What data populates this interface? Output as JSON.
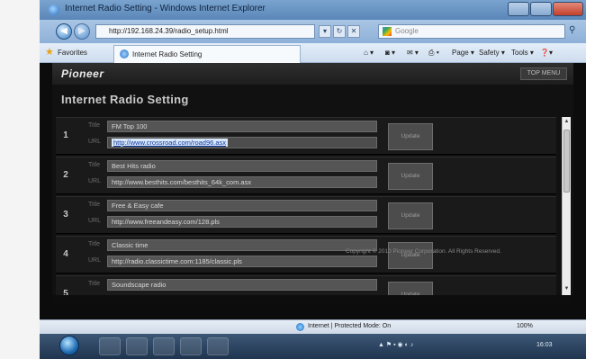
{
  "window": {
    "title": "Internet Radio Setting - Windows Internet Explorer",
    "address": "http://192.168.24.39/radio_setup.html",
    "search_placeholder": "Google"
  },
  "favorites": {
    "label": "Favorites",
    "tab_label": "Internet Radio Setting"
  },
  "commands": [
    "Page ▾",
    "Safety ▾",
    "Tools ▾"
  ],
  "page": {
    "brand": "Pioneer",
    "top_menu": "TOP MENU",
    "title": "Internet Radio Setting",
    "field_labels": {
      "title": "Title",
      "url": "URL"
    },
    "update_label": "Update",
    "copyright": "Copyright © 2010 Pioneer Corporation. All Rights Reserved."
  },
  "stations": [
    {
      "number": "1",
      "title": "FM Top 100",
      "url": "http://www.crossroad.com/road96.asx"
    },
    {
      "number": "2",
      "title": "Best Hits radio",
      "url": "http://www.besthits.com/besthits_64k_com.asx"
    },
    {
      "number": "3",
      "title": "Free & Easy cafe",
      "url": "http://www.freeandeasy.com/128.pls"
    },
    {
      "number": "4",
      "title": "Classic time",
      "url": "http://radio.classictime.com:1185/classic.pls"
    },
    {
      "number": "5",
      "title": "Soundscape radio",
      "url": ""
    }
  ],
  "status": {
    "zone": "Internet | Protected Mode: On",
    "zoom": "100%"
  },
  "taskbar": {
    "clock": "16:03"
  }
}
